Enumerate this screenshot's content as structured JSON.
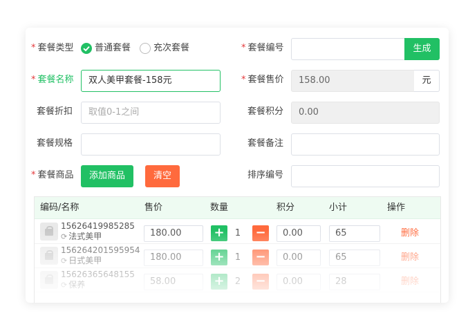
{
  "form": {
    "type": {
      "label": "套餐类型",
      "options": [
        "普通套餐",
        "充次套餐"
      ],
      "selected": 0
    },
    "code": {
      "label": "套餐编号",
      "value": "",
      "generate_label": "生成"
    },
    "name": {
      "label": "套餐名称",
      "value": "双人美甲套餐-158元"
    },
    "price": {
      "label": "套餐售价",
      "value": "158.00",
      "unit": "元"
    },
    "discount": {
      "label": "套餐折扣",
      "placeholder": "取值0-1之间"
    },
    "points": {
      "label": "套餐积分",
      "value": "0.00"
    },
    "spec": {
      "label": "套餐规格",
      "value": ""
    },
    "remark": {
      "label": "套餐备注",
      "value": ""
    },
    "goods": {
      "label": "套餐商品",
      "add_label": "添加商品",
      "clear_label": "清空"
    },
    "sort": {
      "label": "排序编号",
      "value": ""
    }
  },
  "table": {
    "headers": [
      "编码/名称",
      "售价",
      "数量",
      "积分",
      "小计",
      "操作"
    ],
    "rows": [
      {
        "code": "15626419985285",
        "name": "法式美甲",
        "price": "180.00",
        "qty": "1",
        "points": "0.00",
        "subtotal": "65",
        "action": "删除"
      },
      {
        "code": "15626420159595​4",
        "name": "日式美甲",
        "price": "180.00",
        "qty": "1",
        "points": "0.00",
        "subtotal": "65",
        "action": "删除"
      },
      {
        "code": "15626365648155",
        "name": "保养",
        "price": "58.00",
        "qty": "2",
        "points": "0.00",
        "subtotal": "28",
        "action": "删除"
      }
    ]
  },
  "colors": {
    "accent": "#21c064",
    "danger": "#ff6a3d",
    "required": "#e4393c"
  }
}
